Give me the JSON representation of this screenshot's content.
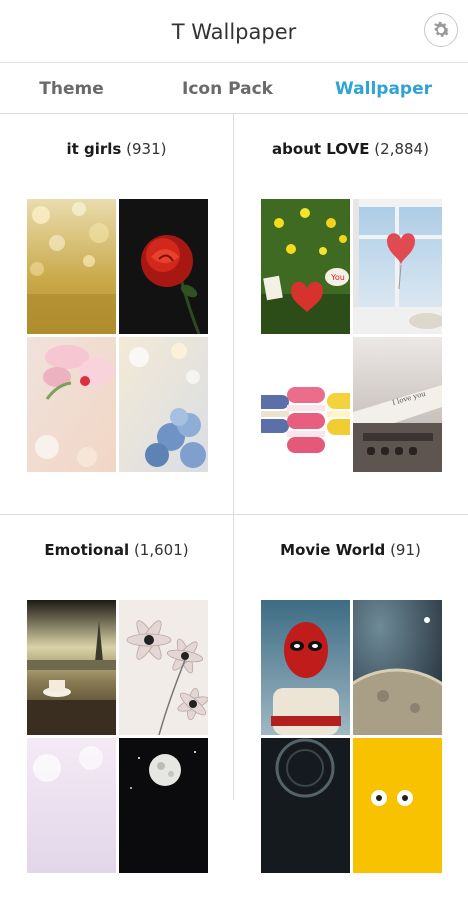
{
  "app": {
    "title": "T Wallpaper",
    "settings_icon": "gear-icon"
  },
  "tabs": [
    {
      "label": "Theme",
      "active": false
    },
    {
      "label": "Icon Pack",
      "active": false
    },
    {
      "label": "Wallpaper",
      "active": true
    }
  ],
  "accent_color": "#2ea3d6",
  "collections": [
    {
      "name": "it girls",
      "count": "(931)"
    },
    {
      "name": "about LOVE",
      "count": "(2,884)"
    },
    {
      "name": "Emotional",
      "count": "(1,601)"
    },
    {
      "name": "Movie World",
      "count": "(91)"
    }
  ]
}
